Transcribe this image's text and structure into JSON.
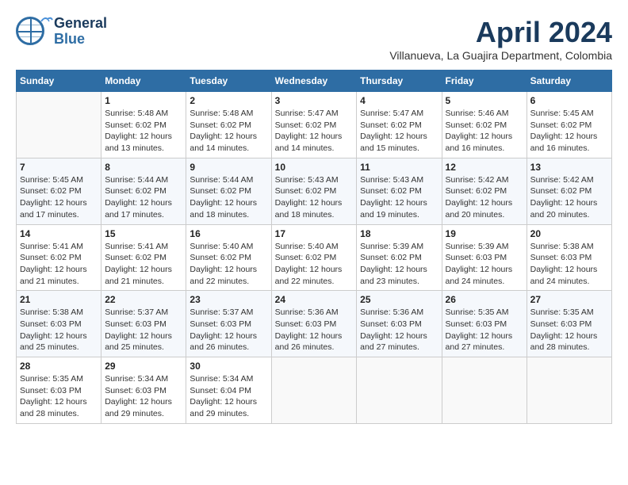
{
  "header": {
    "logo_general": "General",
    "logo_blue": "Blue",
    "month_title": "April 2024",
    "location": "Villanueva, La Guajira Department, Colombia"
  },
  "calendar": {
    "days_of_week": [
      "Sunday",
      "Monday",
      "Tuesday",
      "Wednesday",
      "Thursday",
      "Friday",
      "Saturday"
    ],
    "weeks": [
      [
        {
          "day": "",
          "info": ""
        },
        {
          "day": "1",
          "info": "Sunrise: 5:48 AM\nSunset: 6:02 PM\nDaylight: 12 hours\nand 13 minutes."
        },
        {
          "day": "2",
          "info": "Sunrise: 5:48 AM\nSunset: 6:02 PM\nDaylight: 12 hours\nand 14 minutes."
        },
        {
          "day": "3",
          "info": "Sunrise: 5:47 AM\nSunset: 6:02 PM\nDaylight: 12 hours\nand 14 minutes."
        },
        {
          "day": "4",
          "info": "Sunrise: 5:47 AM\nSunset: 6:02 PM\nDaylight: 12 hours\nand 15 minutes."
        },
        {
          "day": "5",
          "info": "Sunrise: 5:46 AM\nSunset: 6:02 PM\nDaylight: 12 hours\nand 16 minutes."
        },
        {
          "day": "6",
          "info": "Sunrise: 5:45 AM\nSunset: 6:02 PM\nDaylight: 12 hours\nand 16 minutes."
        }
      ],
      [
        {
          "day": "7",
          "info": "Sunrise: 5:45 AM\nSunset: 6:02 PM\nDaylight: 12 hours\nand 17 minutes."
        },
        {
          "day": "8",
          "info": "Sunrise: 5:44 AM\nSunset: 6:02 PM\nDaylight: 12 hours\nand 17 minutes."
        },
        {
          "day": "9",
          "info": "Sunrise: 5:44 AM\nSunset: 6:02 PM\nDaylight: 12 hours\nand 18 minutes."
        },
        {
          "day": "10",
          "info": "Sunrise: 5:43 AM\nSunset: 6:02 PM\nDaylight: 12 hours\nand 18 minutes."
        },
        {
          "day": "11",
          "info": "Sunrise: 5:43 AM\nSunset: 6:02 PM\nDaylight: 12 hours\nand 19 minutes."
        },
        {
          "day": "12",
          "info": "Sunrise: 5:42 AM\nSunset: 6:02 PM\nDaylight: 12 hours\nand 20 minutes."
        },
        {
          "day": "13",
          "info": "Sunrise: 5:42 AM\nSunset: 6:02 PM\nDaylight: 12 hours\nand 20 minutes."
        }
      ],
      [
        {
          "day": "14",
          "info": "Sunrise: 5:41 AM\nSunset: 6:02 PM\nDaylight: 12 hours\nand 21 minutes."
        },
        {
          "day": "15",
          "info": "Sunrise: 5:41 AM\nSunset: 6:02 PM\nDaylight: 12 hours\nand 21 minutes."
        },
        {
          "day": "16",
          "info": "Sunrise: 5:40 AM\nSunset: 6:02 PM\nDaylight: 12 hours\nand 22 minutes."
        },
        {
          "day": "17",
          "info": "Sunrise: 5:40 AM\nSunset: 6:02 PM\nDaylight: 12 hours\nand 22 minutes."
        },
        {
          "day": "18",
          "info": "Sunrise: 5:39 AM\nSunset: 6:02 PM\nDaylight: 12 hours\nand 23 minutes."
        },
        {
          "day": "19",
          "info": "Sunrise: 5:39 AM\nSunset: 6:03 PM\nDaylight: 12 hours\nand 24 minutes."
        },
        {
          "day": "20",
          "info": "Sunrise: 5:38 AM\nSunset: 6:03 PM\nDaylight: 12 hours\nand 24 minutes."
        }
      ],
      [
        {
          "day": "21",
          "info": "Sunrise: 5:38 AM\nSunset: 6:03 PM\nDaylight: 12 hours\nand 25 minutes."
        },
        {
          "day": "22",
          "info": "Sunrise: 5:37 AM\nSunset: 6:03 PM\nDaylight: 12 hours\nand 25 minutes."
        },
        {
          "day": "23",
          "info": "Sunrise: 5:37 AM\nSunset: 6:03 PM\nDaylight: 12 hours\nand 26 minutes."
        },
        {
          "day": "24",
          "info": "Sunrise: 5:36 AM\nSunset: 6:03 PM\nDaylight: 12 hours\nand 26 minutes."
        },
        {
          "day": "25",
          "info": "Sunrise: 5:36 AM\nSunset: 6:03 PM\nDaylight: 12 hours\nand 27 minutes."
        },
        {
          "day": "26",
          "info": "Sunrise: 5:35 AM\nSunset: 6:03 PM\nDaylight: 12 hours\nand 27 minutes."
        },
        {
          "day": "27",
          "info": "Sunrise: 5:35 AM\nSunset: 6:03 PM\nDaylight: 12 hours\nand 28 minutes."
        }
      ],
      [
        {
          "day": "28",
          "info": "Sunrise: 5:35 AM\nSunset: 6:03 PM\nDaylight: 12 hours\nand 28 minutes."
        },
        {
          "day": "29",
          "info": "Sunrise: 5:34 AM\nSunset: 6:03 PM\nDaylight: 12 hours\nand 29 minutes."
        },
        {
          "day": "30",
          "info": "Sunrise: 5:34 AM\nSunset: 6:04 PM\nDaylight: 12 hours\nand 29 minutes."
        },
        {
          "day": "",
          "info": ""
        },
        {
          "day": "",
          "info": ""
        },
        {
          "day": "",
          "info": ""
        },
        {
          "day": "",
          "info": ""
        }
      ]
    ]
  }
}
